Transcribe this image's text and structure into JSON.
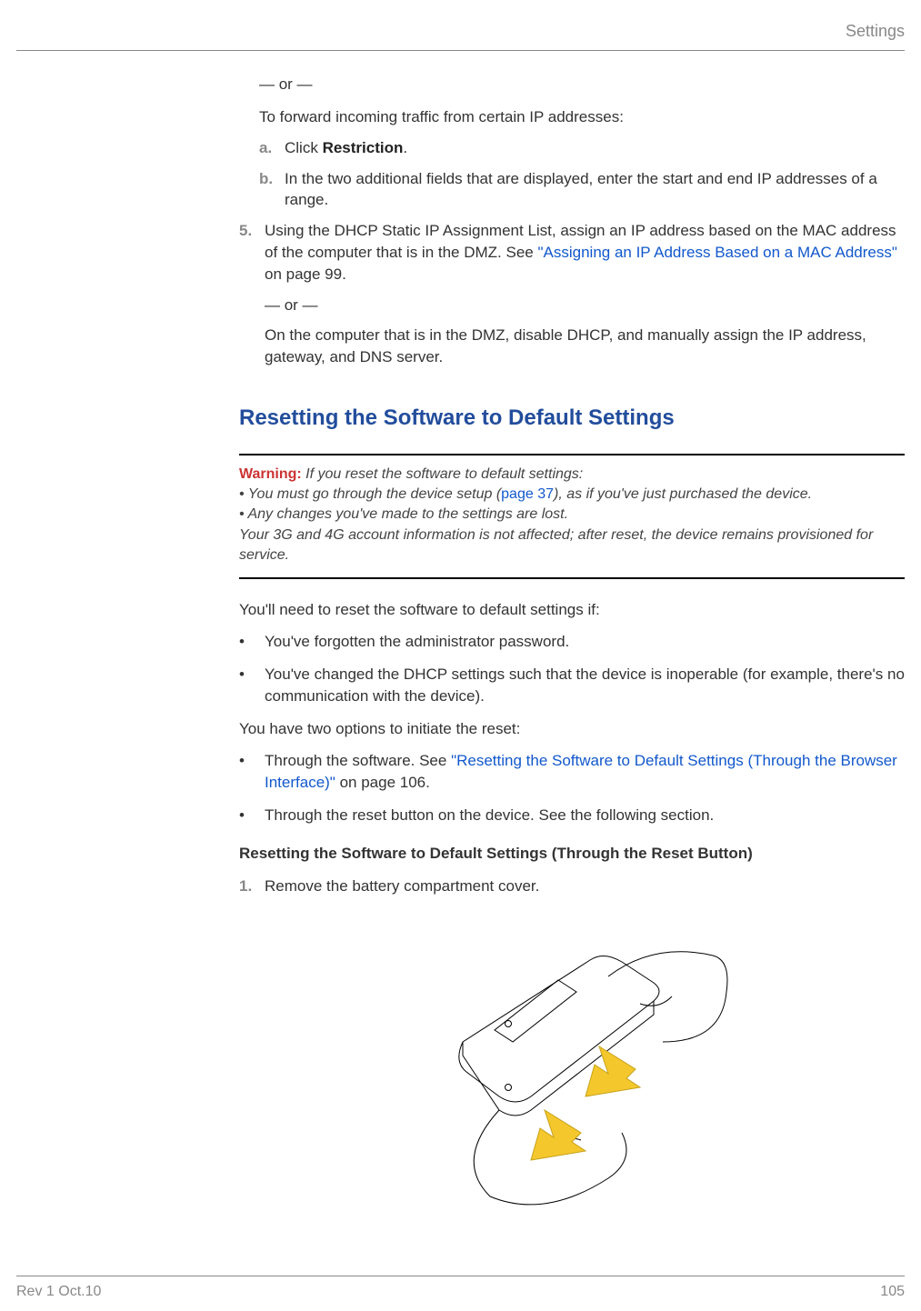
{
  "header": {
    "section": "Settings"
  },
  "body": {
    "or1": "— or —",
    "forward_intro": "To forward incoming traffic from certain IP addresses:",
    "sub_a": {
      "marker": "a.",
      "pre": "Click ",
      "bold": "Restriction",
      "post": "."
    },
    "sub_b": {
      "marker": "b.",
      "text": "In the two additional fields that are displayed, enter the start and end IP addresses of a range."
    },
    "step5": {
      "marker": "5.",
      "text_pre": "Using the DHCP Static IP Assignment List, assign an IP address based on the MAC address of the computer that is in the DMZ. See ",
      "link": "\"Assigning an IP Address Based on a MAC Address\"",
      "text_post": " on page 99.",
      "or": "— or —",
      "alt": "On the computer that is in the DMZ, disable DHCP, and manually assign the IP address, gateway, and DNS server."
    },
    "h2": "Resetting the Software to Default Settings",
    "warn": {
      "label": "Warning:",
      "lead": " If you reset the software to default settings:",
      "b1_pre": "•  You must go through the device setup (",
      "b1_link": "page 37",
      "b1_post": "), as if you've just purchased the device.",
      "b2": "•  Any changes you've made to the settings are lost.",
      "tail": "Your 3G and 4G account information is not affected; after reset, the device remains provisioned for service."
    },
    "need_intro": "You'll need to reset the software to default settings if:",
    "need1": "You've forgotten the administrator password.",
    "need2": "You've changed the DHCP settings such that the device is inoperable (for example, there's no communication with the device).",
    "options_intro": "You have two options to initiate the reset:",
    "opt1_pre": "Through the software. See ",
    "opt1_link": "\"Resetting the Software to Default Settings (Through the Browser Interface)\"",
    "opt1_post": " on page 106.",
    "opt2": "Through the reset button on the device. See the following section.",
    "h3": "Resetting the Software to Default Settings (Through the Reset Button)",
    "reset1": {
      "marker": "1.",
      "text": "Remove the battery compartment cover."
    },
    "bullet": "•"
  },
  "footer": {
    "left": "Rev 1  Oct.10",
    "right": "105"
  }
}
